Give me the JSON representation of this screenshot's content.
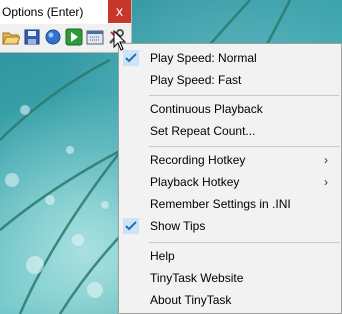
{
  "window": {
    "title": "Options (Enter)",
    "close_label": "x"
  },
  "toolbar": {
    "tools": [
      {
        "name": "open-folder-icon"
      },
      {
        "name": "save-disk-icon"
      },
      {
        "name": "record-icon"
      },
      {
        "name": "play-icon"
      },
      {
        "name": "compile-exe-icon"
      },
      {
        "name": "options-tools-icon"
      }
    ]
  },
  "menu": {
    "items": [
      {
        "label": "Play Speed: Normal",
        "checked": true
      },
      {
        "label": "Play Speed: Fast",
        "checked": false
      },
      {
        "label": "Continuous Playback",
        "checked": false
      },
      {
        "label": "Set Repeat Count...",
        "checked": false
      },
      {
        "label": "Recording Hotkey",
        "submenu": true
      },
      {
        "label": "Playback Hotkey",
        "submenu": true
      },
      {
        "label": "Remember Settings in .INI",
        "checked": false
      },
      {
        "label": "Show Tips",
        "checked": true
      },
      {
        "label": "Help",
        "checked": false
      },
      {
        "label": "TinyTask Website",
        "checked": false
      },
      {
        "label": "About TinyTask",
        "checked": false
      }
    ],
    "submenu_arrow": "›"
  },
  "colors": {
    "check_highlight": "#cce4f7",
    "check_mark": "#2b6cb0",
    "close_button": "#c7352b"
  }
}
